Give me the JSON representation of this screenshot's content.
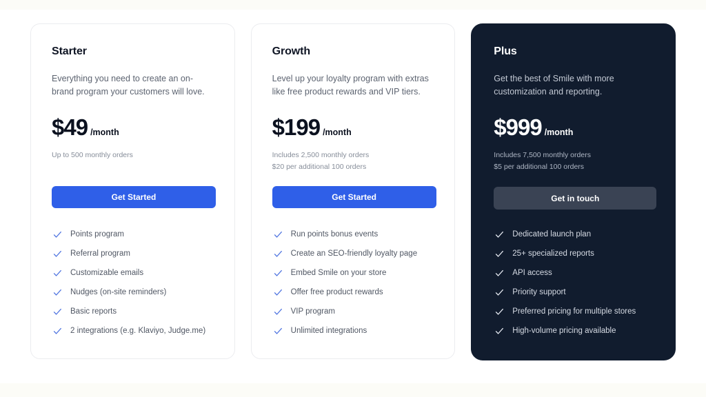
{
  "theme": {
    "page_background": "#ffffff",
    "band_color": "#fcfcf7",
    "accent_blue": "#2f5fe8",
    "dark_card": "#111c2e",
    "dark_button": "#3a4354",
    "check_blue": "#4f74e0",
    "check_light": "#e6eaf2"
  },
  "plans": [
    {
      "name": "Starter",
      "description": "Everything you need to create an on-brand program your customers will love.",
      "price": "$49",
      "period": "/month",
      "notes": [
        "Up to 500 monthly orders"
      ],
      "cta_label": "Get Started",
      "features": [
        "Points program",
        "Referral program",
        "Customizable emails",
        "Nudges (on-site reminders)",
        "Basic reports",
        "2 integrations (e.g. Klaviyo, Judge.me)"
      ]
    },
    {
      "name": "Growth",
      "description": "Level up your loyalty program with extras like free product rewards and VIP tiers.",
      "price": "$199",
      "period": "/month",
      "notes": [
        "Includes 2,500 monthly orders",
        "$20 per additional 100 orders"
      ],
      "cta_label": "Get Started",
      "features": [
        "Run points bonus events",
        "Create an SEO-friendly loyalty page",
        "Embed Smile on your store",
        "Offer free product rewards",
        "VIP program",
        "Unlimited integrations"
      ]
    },
    {
      "name": "Plus",
      "description": "Get the best of Smile with more customization and reporting.",
      "price": "$999",
      "period": "/month",
      "notes": [
        "Includes 7,500 monthly orders",
        "$5 per additional 100 orders"
      ],
      "cta_label": "Get in touch",
      "features": [
        "Dedicated launch plan",
        "25+ specialized reports",
        "API access",
        "Priority support",
        "Preferred pricing for multiple stores",
        "High-volume pricing available"
      ]
    }
  ]
}
